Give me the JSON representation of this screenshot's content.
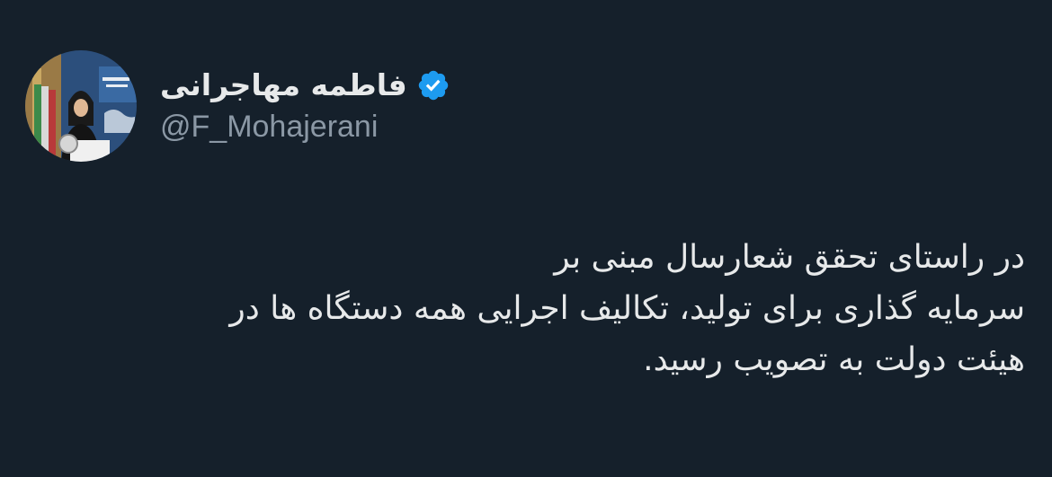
{
  "user": {
    "display_name": "فاطمه مهاجرانی",
    "handle": "@F_Mohajerani",
    "verified": true,
    "avatar_icon": "profile-photo-avatar",
    "verified_icon": "verified-badge-icon",
    "verified_color": "#1d9bf0"
  },
  "tweet": {
    "text": "در راستای تحقق شعارسال مبنی بر\nسرمایه گذاری برای تولید، تکالیف اجرایی همه دستگاه ها در\nهیئت دولت به تصویب رسید."
  },
  "theme": {
    "background": "#15202b",
    "primary_text": "#e7e9ea",
    "secondary_text": "#8b98a5"
  }
}
